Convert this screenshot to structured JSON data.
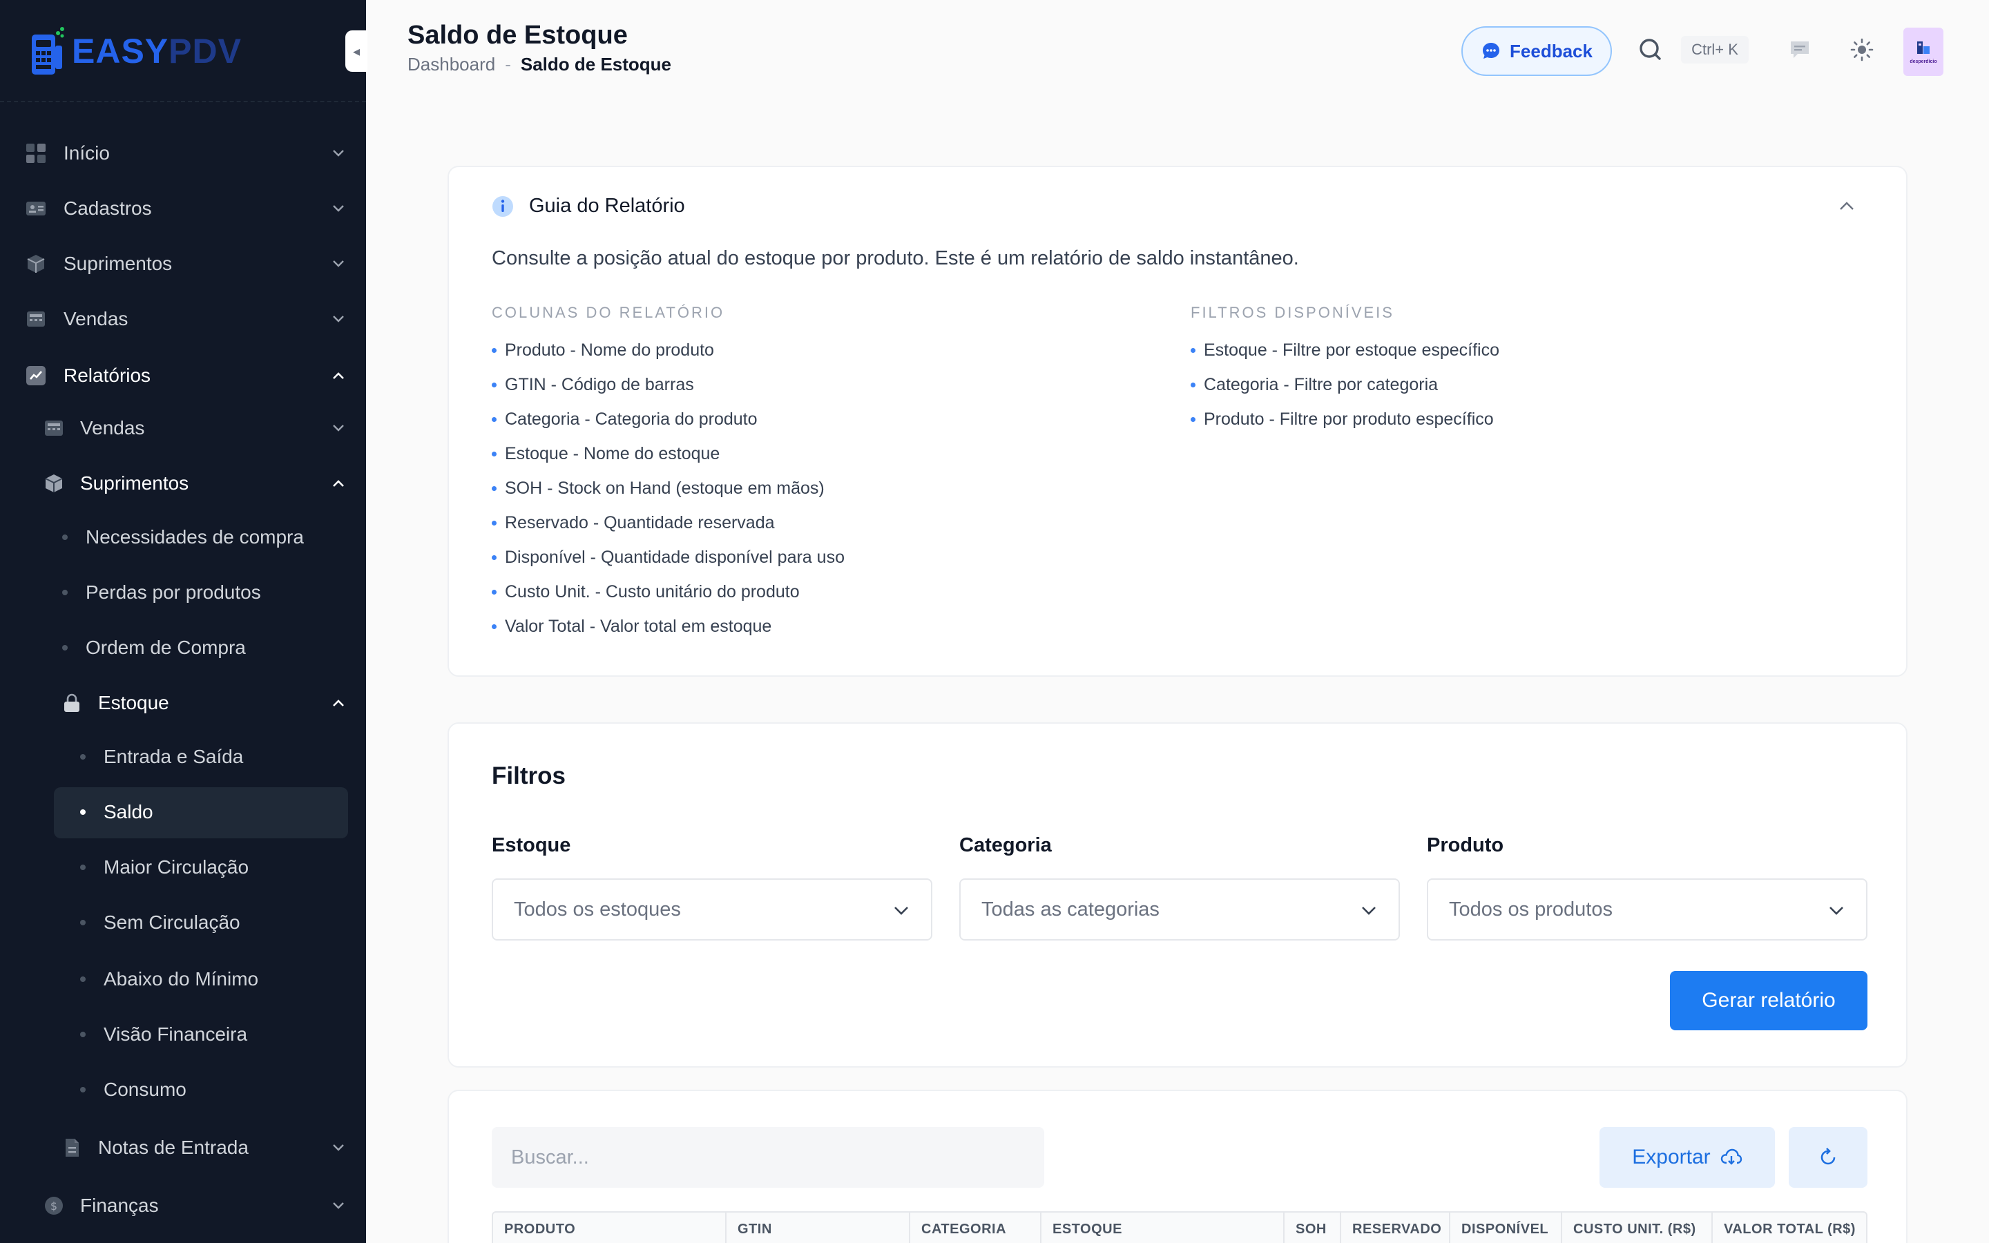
{
  "app": {
    "logo_easy": "EASY",
    "logo_pdv": "PDV",
    "collapse_glyph": "◂"
  },
  "sidebar": {
    "items": [
      {
        "label": "Início",
        "icon": "grid-icon"
      },
      {
        "label": "Cadastros",
        "icon": "id-card-icon"
      },
      {
        "label": "Suprimentos",
        "icon": "box-icon"
      },
      {
        "label": "Vendas",
        "icon": "register-icon"
      },
      {
        "label": "Relatórios",
        "icon": "chart-icon"
      }
    ],
    "reports": {
      "vendas": "Vendas",
      "suprimentos": "Suprimentos",
      "suprimentos_children": [
        "Necessidades de compra",
        "Perdas por produtos",
        "Ordem de Compra"
      ],
      "estoque": "Estoque",
      "estoque_children": [
        "Entrada e Saída",
        "Saldo",
        "Maior Circulação",
        "Sem Circulação",
        "Abaixo do Mínimo",
        "Visão Financeira",
        "Consumo"
      ],
      "notas": "Notas de Entrada"
    },
    "financas": "Finanças"
  },
  "header": {
    "title": "Saldo de Estoque",
    "breadcrumb_link": "Dashboard",
    "breadcrumb_sep": "-",
    "breadcrumb_current": "Saldo de Estoque",
    "feedback_label": "Feedback",
    "shortcut": "Ctrl+ K",
    "avatar_text": "desperdício"
  },
  "guide": {
    "title": "Guia do Relatório",
    "description": "Consulte a posição atual do estoque por produto. Este é um relatório de saldo instantâneo.",
    "columns_title": "COLUNAS DO RELATÓRIO",
    "columns": [
      "Produto - Nome do produto",
      "GTIN - Código de barras",
      "Categoria - Categoria do produto",
      "Estoque - Nome do estoque",
      "SOH - Stock on Hand (estoque em mãos)",
      "Reservado - Quantidade reservada",
      "Disponível - Quantidade disponível para uso",
      "Custo Unit. - Custo unitário do produto",
      "Valor Total - Valor total em estoque"
    ],
    "filters_title": "FILTROS DISPONÍVEIS",
    "filters": [
      "Estoque - Filtre por estoque específico",
      "Categoria - Filtre por categoria",
      "Produto - Filtre por produto específico"
    ]
  },
  "filters": {
    "title": "Filtros",
    "estoque_label": "Estoque",
    "estoque_value": "Todos os estoques",
    "categoria_label": "Categoria",
    "categoria_value": "Todas as categorias",
    "produto_label": "Produto",
    "produto_value": "Todos os produtos",
    "generate_label": "Gerar relatório"
  },
  "table": {
    "search_placeholder": "Buscar...",
    "export_label": "Exportar",
    "columns": [
      "PRODUTO",
      "GTIN",
      "CATEGORIA",
      "ESTOQUE",
      "SOH",
      "RESERVADO",
      "DISPONÍVEL",
      "CUSTO UNIT. (R$)",
      "VALOR TOTAL (R$)"
    ]
  },
  "colors": {
    "sidebar_bg": "#111827",
    "primary": "#1d7cf2",
    "bullet": "#3b82f6"
  }
}
